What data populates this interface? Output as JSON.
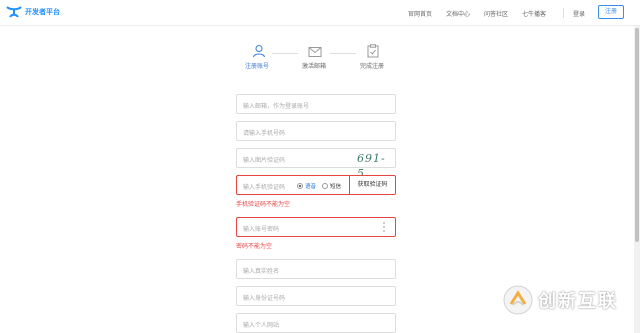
{
  "header": {
    "logo_text": "开发者平台",
    "nav": [
      "官网首页",
      "文档中心",
      "问答社区",
      "七牛播客"
    ],
    "login": "登录",
    "register": "注册"
  },
  "steps": [
    {
      "label": "注册账号",
      "active": true
    },
    {
      "label": "激活邮箱",
      "active": false
    },
    {
      "label": "完成注册",
      "active": false
    }
  ],
  "form": {
    "email_placeholder": "输入邮箱，作为登录账号",
    "phone_placeholder": "请输入手机号码",
    "captcha_placeholder": "输入图片验证码",
    "captcha_text": "691-5",
    "sms_placeholder": "输入手机验证码",
    "radio_voice": "语音",
    "radio_sms": "短信",
    "get_code": "获取验证码",
    "sms_error": "手机验证码不能为空",
    "password_placeholder": "输入账号密码",
    "password_error": "密码不能为空",
    "realname_placeholder": "输入真实姓名",
    "idcard_placeholder": "输入身份证号码",
    "website_placeholder": "输入个人网站"
  },
  "watermark": "创新互联",
  "colors": {
    "brand": "#1e90ff",
    "error": "#e64545",
    "active_step": "#3a7bd5"
  }
}
